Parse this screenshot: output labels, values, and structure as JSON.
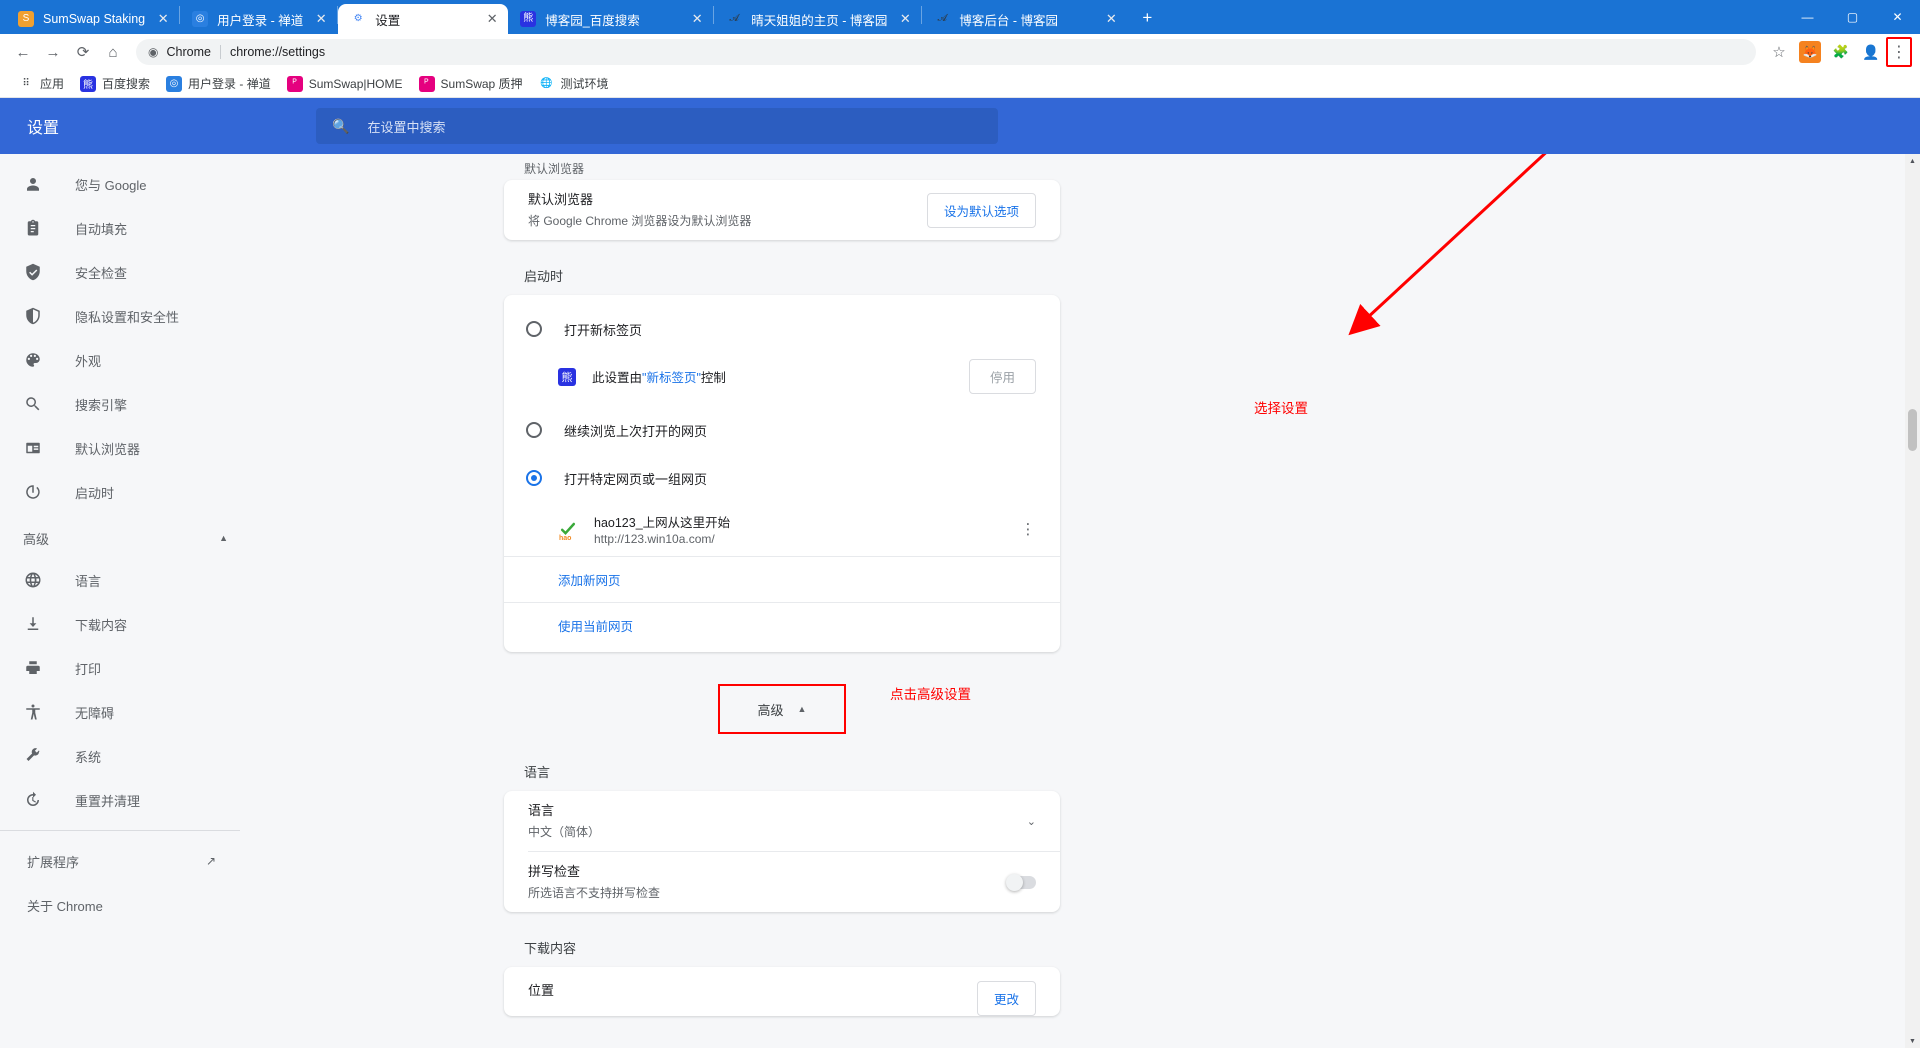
{
  "window": {
    "minimize": "—",
    "maximize": "▢",
    "close": "✕",
    "new_tab": "+"
  },
  "tabs": [
    {
      "title": "SumSwap Staking",
      "favicon": "sumswap-icon",
      "glyph": "S",
      "active": false,
      "close": "✕"
    },
    {
      "title": "用户登录 - 禅道",
      "favicon": "zentao-icon",
      "glyph": "◎",
      "active": false,
      "close": "✕"
    },
    {
      "title": "设置",
      "favicon": "gear-icon",
      "glyph": "⚙",
      "active": true,
      "close": "✕"
    },
    {
      "title": "博客园_百度搜索",
      "favicon": "baidu-icon",
      "glyph": "熊",
      "active": false,
      "close": "✕"
    },
    {
      "title": "晴天姐姐的主页 - 博客园",
      "favicon": "cnblogs-icon",
      "glyph": "𝓐",
      "active": false,
      "close": "✕"
    },
    {
      "title": "博客后台 - 博客园",
      "favicon": "cnblogs-icon",
      "glyph": "𝓐",
      "active": false,
      "close": "✕"
    }
  ],
  "toolbar": {
    "back": "←",
    "forward": "→",
    "reload": "⟳",
    "home": "⌂",
    "omnibox_icon": "chrome-icon",
    "omnibox_scheme": "Chrome",
    "omnibox_url": "chrome://settings",
    "bookmark_star": "☆",
    "extension_badge": "🦊",
    "extensions": "🧩",
    "profile": "👤",
    "menu": "⋮"
  },
  "bookmarks": [
    {
      "label": "应用",
      "icon": "apps-grid-icon",
      "glyph": "⠿"
    },
    {
      "label": "百度搜索",
      "icon": "baidu-icon",
      "glyph": "熊"
    },
    {
      "label": "用户登录 - 禅道",
      "icon": "zentao-icon",
      "glyph": "◎"
    },
    {
      "label": "SumSwap|HOME",
      "icon": "sumswap-pink-icon",
      "glyph": "ᴾ"
    },
    {
      "label": "SumSwap 质押",
      "icon": "sumswap-pink-icon",
      "glyph": "ᴾ"
    },
    {
      "label": "测试环境",
      "icon": "globe-icon",
      "glyph": "🌐"
    }
  ],
  "settings": {
    "title": "设置",
    "search_placeholder": "在设置中搜索",
    "search_icon": "search-icon"
  },
  "sidebar": {
    "items": [
      {
        "label": "您与 Google",
        "icon": "person-icon"
      },
      {
        "label": "自动填充",
        "icon": "clipboard-icon"
      },
      {
        "label": "安全检查",
        "icon": "shield-check-icon"
      },
      {
        "label": "隐私设置和安全性",
        "icon": "shield-icon"
      },
      {
        "label": "外观",
        "icon": "palette-icon"
      },
      {
        "label": "搜索引擎",
        "icon": "search-icon"
      },
      {
        "label": "默认浏览器",
        "icon": "browser-window-icon"
      },
      {
        "label": "启动时",
        "icon": "power-icon"
      }
    ],
    "advanced_group": {
      "label": "高级",
      "arrow": "▲"
    },
    "advanced_items": [
      {
        "label": "语言",
        "icon": "globe-icon"
      },
      {
        "label": "下载内容",
        "icon": "download-icon"
      },
      {
        "label": "打印",
        "icon": "printer-icon"
      },
      {
        "label": "无障碍",
        "icon": "accessibility-icon"
      },
      {
        "label": "系统",
        "icon": "wrench-icon"
      },
      {
        "label": "重置并清理",
        "icon": "restore-icon"
      }
    ],
    "footer_items": [
      {
        "label": "扩展程序",
        "icon": "external-link-icon",
        "ext": "↗"
      },
      {
        "label": "关于 Chrome",
        "icon": ""
      }
    ]
  },
  "main": {
    "cut_section_title": "默认浏览器",
    "default_browser": {
      "title": "默认浏览器",
      "subtitle": "将 Google Chrome 浏览器设为默认浏览器",
      "button": "设为默认选项"
    },
    "startup": {
      "section_title": "启动时",
      "options": [
        {
          "label": "打开新标签页",
          "checked": false
        },
        {
          "label": "继续浏览上次打开的网页",
          "checked": false
        },
        {
          "label": "打开特定网页或一组网页",
          "checked": true
        }
      ],
      "controlled_notice": {
        "icon": "baidu-extension-icon",
        "text_before": "此设置由",
        "link": "\"新标签页\"",
        "text_after": "控制",
        "button": "停用"
      },
      "sites": [
        {
          "name": "hao123_上网从这里开始",
          "url": "http://123.win10a.com/",
          "favicon": "hao123-icon",
          "more": "⋮"
        }
      ],
      "add_page_link": "添加新网页",
      "use_current_link": "使用当前网页"
    },
    "advanced_button": {
      "label": "高级",
      "arrow": "▲"
    },
    "language": {
      "section_title": "语言",
      "language_row": {
        "title": "语言",
        "value": "中文（简体）",
        "chevron": "⌄"
      },
      "spellcheck_row": {
        "title": "拼写检查",
        "subtitle": "所选语言不支持拼写检查",
        "toggle_on": false
      }
    },
    "downloads": {
      "section_title": "下载内容",
      "location_row": {
        "title": "位置",
        "button": "更改"
      }
    }
  },
  "annotations": [
    {
      "text": "选择设置",
      "name": "annotation-select-settings"
    },
    {
      "text": "点击高级设置",
      "name": "annotation-click-advanced"
    }
  ]
}
